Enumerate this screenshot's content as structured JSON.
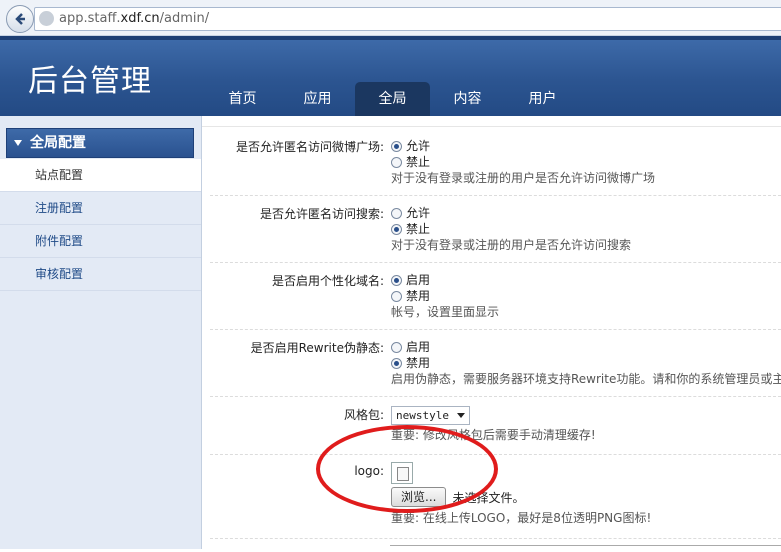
{
  "browser": {
    "url_prefix": "app.staff.",
    "url_domain": "xdf.cn",
    "url_path": "/admin/"
  },
  "header": {
    "title": "后台管理",
    "nav": [
      "首页",
      "应用",
      "全局",
      "内容",
      "用户"
    ],
    "active_nav": "全局"
  },
  "sidebar": {
    "group_title": "全局配置",
    "items": [
      "站点配置",
      "注册配置",
      "附件配置",
      "审核配置"
    ],
    "active_item": "站点配置"
  },
  "settings": {
    "weibo": {
      "label": "是否允许匿名访问微博广场:",
      "options": [
        "允许",
        "禁止"
      ],
      "selected": "允许",
      "hint": "对于没有登录或注册的用户是否允许访问微博广场"
    },
    "search": {
      "label": "是否允许匿名访问搜索:",
      "options": [
        "允许",
        "禁止"
      ],
      "selected": "禁止",
      "hint": "对于没有登录或注册的用户是否允许访问搜索"
    },
    "domain": {
      "label": "是否启用个性化域名:",
      "options": [
        "启用",
        "禁用"
      ],
      "selected": "启用",
      "hint": "帐号，设置里面显示"
    },
    "rewrite": {
      "label": "是否启用Rewrite伪静态:",
      "options": [
        "启用",
        "禁用"
      ],
      "selected": "禁用",
      "hint": "启用伪静态，需要服务器环境支持Rewrite功能。请和你的系统管理员或主"
    },
    "style": {
      "label": "风格包:",
      "value": "newstyle",
      "hint": "重要: 修改风格包后需要手动清理缓存!"
    },
    "logo": {
      "label": "logo:",
      "browse_label": "浏览...",
      "file_status": "未选择文件。",
      "hint": "重要: 在线上传LOGO，最好是8位透明PNG图标!"
    }
  },
  "colors": {
    "header_blue": "#2c5591",
    "annotation_red": "#e01c1c"
  }
}
